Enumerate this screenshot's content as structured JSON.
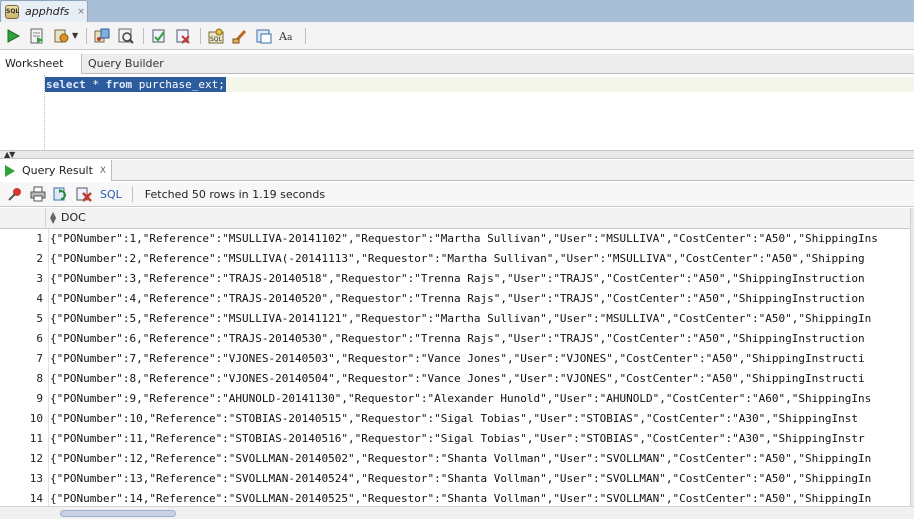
{
  "doc_tab": {
    "title": "apphdfs",
    "close": "×",
    "icon": "database-connection-icon"
  },
  "toolbar": {
    "icons": [
      "run-statement-icon",
      "run-script-icon",
      "autotrace-icon",
      "explain-plan-icon",
      "sql-tuning-icon",
      "commit-icon",
      "rollback-icon",
      "sql-history-icon",
      "clear-icon",
      "format-sql-icon",
      "to-upper-lower-icon"
    ]
  },
  "worksheet_tabs": {
    "worksheet": "Worksheet",
    "query_builder": "Query Builder"
  },
  "editor": {
    "keyword_select": "select",
    "star": " * ",
    "keyword_from": "from",
    "table": " purchase_ext;"
  },
  "result_tab": {
    "label": "Query Result",
    "close": "X"
  },
  "result_toolbar": {
    "sql_link": "SQL",
    "message": "Fetched 50 rows in 1.19 seconds"
  },
  "grid": {
    "column": "DOC",
    "rows": [
      {
        "n": "1",
        "doc": "{\"PONumber\":1,\"Reference\":\"MSULLIVA-20141102\",\"Requestor\":\"Martha Sullivan\",\"User\":\"MSULLIVA\",\"CostCenter\":\"A50\",\"ShippingIns"
      },
      {
        "n": "2",
        "doc": "{\"PONumber\":2,\"Reference\":\"MSULLIVA(-20141113\",\"Requestor\":\"Martha Sullivan\",\"User\":\"MSULLIVA\",\"CostCenter\":\"A50\",\"Shipping"
      },
      {
        "n": "3",
        "doc": "{\"PONumber\":3,\"Reference\":\"TRAJS-20140518\",\"Requestor\":\"Trenna Rajs\",\"User\":\"TRAJS\",\"CostCenter\":\"A50\",\"ShippingInstruction"
      },
      {
        "n": "4",
        "doc": "{\"PONumber\":4,\"Reference\":\"TRAJS-20140520\",\"Requestor\":\"Trenna Rajs\",\"User\":\"TRAJS\",\"CostCenter\":\"A50\",\"ShippingInstruction"
      },
      {
        "n": "5",
        "doc": "{\"PONumber\":5,\"Reference\":\"MSULLIVA-20141121\",\"Requestor\":\"Martha Sullivan\",\"User\":\"MSULLIVA\",\"CostCenter\":\"A50\",\"ShippingIn"
      },
      {
        "n": "6",
        "doc": "{\"PONumber\":6,\"Reference\":\"TRAJS-20140530\",\"Requestor\":\"Trenna Rajs\",\"User\":\"TRAJS\",\"CostCenter\":\"A50\",\"ShippingInstruction"
      },
      {
        "n": "7",
        "doc": "{\"PONumber\":7,\"Reference\":\"VJONES-20140503\",\"Requestor\":\"Vance Jones\",\"User\":\"VJONES\",\"CostCenter\":\"A50\",\"ShippingInstructi"
      },
      {
        "n": "8",
        "doc": "{\"PONumber\":8,\"Reference\":\"VJONES-20140504\",\"Requestor\":\"Vance Jones\",\"User\":\"VJONES\",\"CostCenter\":\"A50\",\"ShippingInstructi"
      },
      {
        "n": "9",
        "doc": "{\"PONumber\":9,\"Reference\":\"AHUNOLD-20141130\",\"Requestor\":\"Alexander Hunold\",\"User\":\"AHUNOLD\",\"CostCenter\":\"A60\",\"ShippingIns"
      },
      {
        "n": "10",
        "doc": "{\"PONumber\":10,\"Reference\":\"STOBIAS-20140515\",\"Requestor\":\"Sigal Tobias\",\"User\":\"STOBIAS\",\"CostCenter\":\"A30\",\"ShippingInst"
      },
      {
        "n": "11",
        "doc": "{\"PONumber\":11,\"Reference\":\"STOBIAS-20140516\",\"Requestor\":\"Sigal Tobias\",\"User\":\"STOBIAS\",\"CostCenter\":\"A30\",\"ShippingInstr"
      },
      {
        "n": "12",
        "doc": "{\"PONumber\":12,\"Reference\":\"SVOLLMAN-20140502\",\"Requestor\":\"Shanta Vollman\",\"User\":\"SVOLLMAN\",\"CostCenter\":\"A50\",\"ShippingIn"
      },
      {
        "n": "13",
        "doc": "{\"PONumber\":13,\"Reference\":\"SVOLLMAN-20140524\",\"Requestor\":\"Shanta Vollman\",\"User\":\"SVOLLMAN\",\"CostCenter\":\"A50\",\"ShippingIn"
      },
      {
        "n": "14",
        "doc": "{\"PONumber\":14,\"Reference\":\"SVOLLMAN-20140525\",\"Requestor\":\"Shanta Vollman\",\"User\":\"SVOLLMAN\",\"CostCenter\":\"A50\",\"ShippingIn"
      }
    ]
  },
  "colors": {
    "selection": "#2c5c9c",
    "run_green": "#2fa23a",
    "tab_strip": "#a9bfd6",
    "link": "#2a5db0"
  }
}
